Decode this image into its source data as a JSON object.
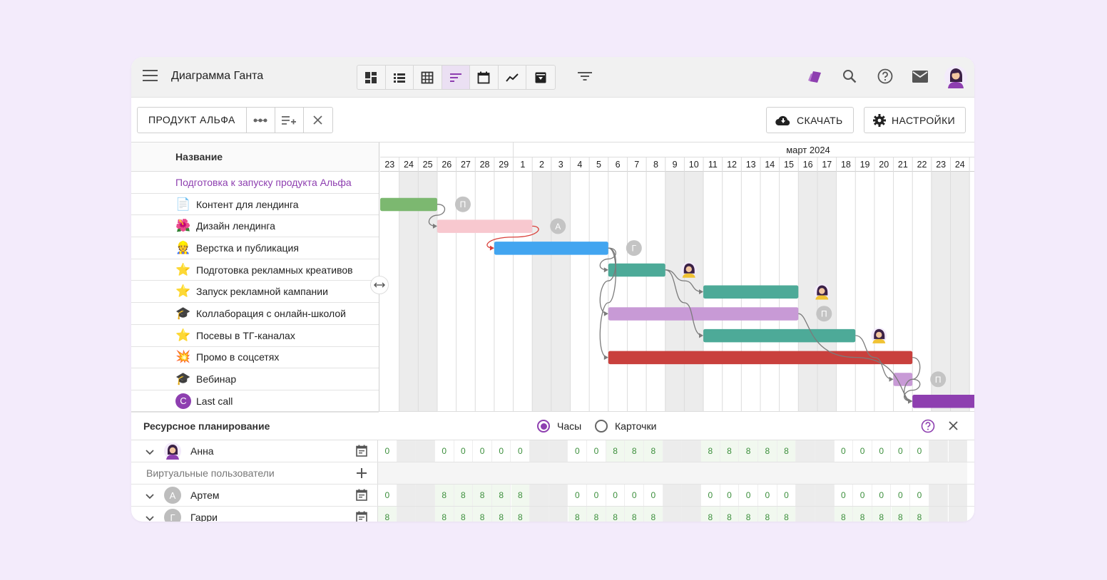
{
  "app": {
    "title": "Диаграмма Ганта"
  },
  "toolbar": {
    "project": "ПРОДУКТ АЛЬФА",
    "download": "СКАЧАТЬ",
    "settings": "НАСТРОЙКИ"
  },
  "gantt": {
    "name_header": "Название",
    "month_label": "март 2024",
    "days": [
      "23",
      "24",
      "25",
      "26",
      "27",
      "28",
      "29",
      "1",
      "2",
      "3",
      "4",
      "5",
      "6",
      "7",
      "8",
      "9",
      "10",
      "11",
      "12",
      "13",
      "14",
      "15",
      "16",
      "17",
      "18",
      "19",
      "20",
      "21",
      "22",
      "23",
      "24"
    ],
    "weekend_cols": [
      1,
      2,
      8,
      9,
      15,
      16,
      22,
      23,
      29,
      30
    ],
    "tasks": [
      {
        "name": "Подготовка к запуску продукта Альфа",
        "group": true
      },
      {
        "name": "Контент для лендинга",
        "icon": "📄",
        "start": 0,
        "end": 3,
        "color": "#7cb870",
        "assignee": "П"
      },
      {
        "name": "Дизайн лендинга",
        "icon": "🌺",
        "start": 3,
        "end": 8,
        "color": "#f8c8cf",
        "assignee": "А"
      },
      {
        "name": "Верстка и публикация",
        "icon": "👷",
        "start": 6,
        "end": 12,
        "color": "#42a5f0",
        "assignee": "Г"
      },
      {
        "name": "Подготовка рекламных креативов",
        "icon": "⭐",
        "start": 12,
        "end": 15,
        "color": "#4daa98",
        "assignee": "avatar"
      },
      {
        "name": "Запуск рекламной кампании",
        "icon": "⭐",
        "start": 17,
        "end": 22,
        "color": "#4daa98",
        "assignee": "avatar"
      },
      {
        "name": "Коллаборация с онлайн-школой",
        "icon": "🎓",
        "start": 12,
        "end": 22,
        "color": "#c89ad6",
        "assignee": "П"
      },
      {
        "name": "Посевы в ТГ-каналах",
        "icon": "⭐",
        "start": 17,
        "end": 25,
        "color": "#4daa98",
        "assignee": "avatar"
      },
      {
        "name": "Промо в соцсетях",
        "icon": "💥",
        "start": 12,
        "end": 28,
        "color": "#c9403d",
        "assignee": ""
      },
      {
        "name": "Вебинар",
        "icon": "🎓",
        "start": 27,
        "end": 28,
        "color": "#c89ad6",
        "assignee": "П"
      },
      {
        "name": "Last call",
        "icon": "C",
        "start": 28,
        "end": 31.5,
        "color": "#8e3fb0",
        "assignee": ""
      }
    ]
  },
  "resources": {
    "title": "Ресурсное планирование",
    "radio_hours": "Часы",
    "radio_cards": "Карточки",
    "virtual_label": "Виртуальные пользователи",
    "people": [
      {
        "name": "Анна",
        "avatar": "photo",
        "values": [
          "0",
          "",
          "",
          "0",
          "0",
          "0",
          "0",
          "0",
          "",
          "",
          "0",
          "0",
          "8",
          "8",
          "8",
          "",
          "",
          "8",
          "8",
          "8",
          "8",
          "8",
          "",
          "",
          "0",
          "0",
          "0",
          "0",
          "0",
          "",
          ""
        ]
      },
      {
        "name": "Артем",
        "avatar": "А",
        "values": [
          "0",
          "",
          "",
          "8",
          "8",
          "8",
          "8",
          "8",
          "",
          "",
          "0",
          "0",
          "0",
          "0",
          "0",
          "",
          "",
          "0",
          "0",
          "0",
          "0",
          "0",
          "",
          "",
          "0",
          "0",
          "0",
          "0",
          "0",
          "",
          ""
        ]
      },
      {
        "name": "Гарри",
        "avatar": "Г",
        "values": [
          "8",
          "",
          "",
          "8",
          "8",
          "8",
          "8",
          "8",
          "",
          "",
          "8",
          "8",
          "8",
          "8",
          "8",
          "",
          "",
          "8",
          "8",
          "8",
          "8",
          "8",
          "",
          "",
          "8",
          "8",
          "8",
          "8",
          "8",
          "",
          ""
        ]
      }
    ]
  },
  "colors": {
    "accent": "#8e3fb0",
    "green_text": "#3c8f3c"
  }
}
